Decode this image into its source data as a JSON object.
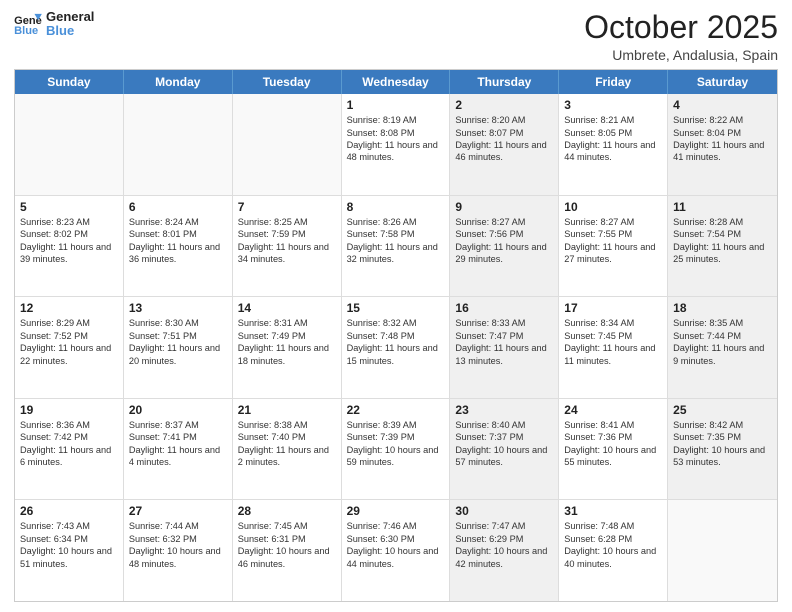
{
  "logo": {
    "general": "General",
    "blue": "Blue"
  },
  "header": {
    "title": "October 2025",
    "subtitle": "Umbrete, Andalusia, Spain"
  },
  "weekdays": [
    "Sunday",
    "Monday",
    "Tuesday",
    "Wednesday",
    "Thursday",
    "Friday",
    "Saturday"
  ],
  "weeks": [
    [
      {
        "day": "",
        "sunrise": "",
        "sunset": "",
        "daylight": "",
        "shaded": false,
        "empty": true
      },
      {
        "day": "",
        "sunrise": "",
        "sunset": "",
        "daylight": "",
        "shaded": false,
        "empty": true
      },
      {
        "day": "",
        "sunrise": "",
        "sunset": "",
        "daylight": "",
        "shaded": false,
        "empty": true
      },
      {
        "day": "1",
        "sunrise": "Sunrise: 8:19 AM",
        "sunset": "Sunset: 8:08 PM",
        "daylight": "Daylight: 11 hours and 48 minutes.",
        "shaded": false,
        "empty": false
      },
      {
        "day": "2",
        "sunrise": "Sunrise: 8:20 AM",
        "sunset": "Sunset: 8:07 PM",
        "daylight": "Daylight: 11 hours and 46 minutes.",
        "shaded": true,
        "empty": false
      },
      {
        "day": "3",
        "sunrise": "Sunrise: 8:21 AM",
        "sunset": "Sunset: 8:05 PM",
        "daylight": "Daylight: 11 hours and 44 minutes.",
        "shaded": false,
        "empty": false
      },
      {
        "day": "4",
        "sunrise": "Sunrise: 8:22 AM",
        "sunset": "Sunset: 8:04 PM",
        "daylight": "Daylight: 11 hours and 41 minutes.",
        "shaded": true,
        "empty": false
      }
    ],
    [
      {
        "day": "5",
        "sunrise": "Sunrise: 8:23 AM",
        "sunset": "Sunset: 8:02 PM",
        "daylight": "Daylight: 11 hours and 39 minutes.",
        "shaded": false,
        "empty": false
      },
      {
        "day": "6",
        "sunrise": "Sunrise: 8:24 AM",
        "sunset": "Sunset: 8:01 PM",
        "daylight": "Daylight: 11 hours and 36 minutes.",
        "shaded": false,
        "empty": false
      },
      {
        "day": "7",
        "sunrise": "Sunrise: 8:25 AM",
        "sunset": "Sunset: 7:59 PM",
        "daylight": "Daylight: 11 hours and 34 minutes.",
        "shaded": false,
        "empty": false
      },
      {
        "day": "8",
        "sunrise": "Sunrise: 8:26 AM",
        "sunset": "Sunset: 7:58 PM",
        "daylight": "Daylight: 11 hours and 32 minutes.",
        "shaded": false,
        "empty": false
      },
      {
        "day": "9",
        "sunrise": "Sunrise: 8:27 AM",
        "sunset": "Sunset: 7:56 PM",
        "daylight": "Daylight: 11 hours and 29 minutes.",
        "shaded": true,
        "empty": false
      },
      {
        "day": "10",
        "sunrise": "Sunrise: 8:27 AM",
        "sunset": "Sunset: 7:55 PM",
        "daylight": "Daylight: 11 hours and 27 minutes.",
        "shaded": false,
        "empty": false
      },
      {
        "day": "11",
        "sunrise": "Sunrise: 8:28 AM",
        "sunset": "Sunset: 7:54 PM",
        "daylight": "Daylight: 11 hours and 25 minutes.",
        "shaded": true,
        "empty": false
      }
    ],
    [
      {
        "day": "12",
        "sunrise": "Sunrise: 8:29 AM",
        "sunset": "Sunset: 7:52 PM",
        "daylight": "Daylight: 11 hours and 22 minutes.",
        "shaded": false,
        "empty": false
      },
      {
        "day": "13",
        "sunrise": "Sunrise: 8:30 AM",
        "sunset": "Sunset: 7:51 PM",
        "daylight": "Daylight: 11 hours and 20 minutes.",
        "shaded": false,
        "empty": false
      },
      {
        "day": "14",
        "sunrise": "Sunrise: 8:31 AM",
        "sunset": "Sunset: 7:49 PM",
        "daylight": "Daylight: 11 hours and 18 minutes.",
        "shaded": false,
        "empty": false
      },
      {
        "day": "15",
        "sunrise": "Sunrise: 8:32 AM",
        "sunset": "Sunset: 7:48 PM",
        "daylight": "Daylight: 11 hours and 15 minutes.",
        "shaded": false,
        "empty": false
      },
      {
        "day": "16",
        "sunrise": "Sunrise: 8:33 AM",
        "sunset": "Sunset: 7:47 PM",
        "daylight": "Daylight: 11 hours and 13 minutes.",
        "shaded": true,
        "empty": false
      },
      {
        "day": "17",
        "sunrise": "Sunrise: 8:34 AM",
        "sunset": "Sunset: 7:45 PM",
        "daylight": "Daylight: 11 hours and 11 minutes.",
        "shaded": false,
        "empty": false
      },
      {
        "day": "18",
        "sunrise": "Sunrise: 8:35 AM",
        "sunset": "Sunset: 7:44 PM",
        "daylight": "Daylight: 11 hours and 9 minutes.",
        "shaded": true,
        "empty": false
      }
    ],
    [
      {
        "day": "19",
        "sunrise": "Sunrise: 8:36 AM",
        "sunset": "Sunset: 7:42 PM",
        "daylight": "Daylight: 11 hours and 6 minutes.",
        "shaded": false,
        "empty": false
      },
      {
        "day": "20",
        "sunrise": "Sunrise: 8:37 AM",
        "sunset": "Sunset: 7:41 PM",
        "daylight": "Daylight: 11 hours and 4 minutes.",
        "shaded": false,
        "empty": false
      },
      {
        "day": "21",
        "sunrise": "Sunrise: 8:38 AM",
        "sunset": "Sunset: 7:40 PM",
        "daylight": "Daylight: 11 hours and 2 minutes.",
        "shaded": false,
        "empty": false
      },
      {
        "day": "22",
        "sunrise": "Sunrise: 8:39 AM",
        "sunset": "Sunset: 7:39 PM",
        "daylight": "Daylight: 10 hours and 59 minutes.",
        "shaded": false,
        "empty": false
      },
      {
        "day": "23",
        "sunrise": "Sunrise: 8:40 AM",
        "sunset": "Sunset: 7:37 PM",
        "daylight": "Daylight: 10 hours and 57 minutes.",
        "shaded": true,
        "empty": false
      },
      {
        "day": "24",
        "sunrise": "Sunrise: 8:41 AM",
        "sunset": "Sunset: 7:36 PM",
        "daylight": "Daylight: 10 hours and 55 minutes.",
        "shaded": false,
        "empty": false
      },
      {
        "day": "25",
        "sunrise": "Sunrise: 8:42 AM",
        "sunset": "Sunset: 7:35 PM",
        "daylight": "Daylight: 10 hours and 53 minutes.",
        "shaded": true,
        "empty": false
      }
    ],
    [
      {
        "day": "26",
        "sunrise": "Sunrise: 7:43 AM",
        "sunset": "Sunset: 6:34 PM",
        "daylight": "Daylight: 10 hours and 51 minutes.",
        "shaded": false,
        "empty": false
      },
      {
        "day": "27",
        "sunrise": "Sunrise: 7:44 AM",
        "sunset": "Sunset: 6:32 PM",
        "daylight": "Daylight: 10 hours and 48 minutes.",
        "shaded": false,
        "empty": false
      },
      {
        "day": "28",
        "sunrise": "Sunrise: 7:45 AM",
        "sunset": "Sunset: 6:31 PM",
        "daylight": "Daylight: 10 hours and 46 minutes.",
        "shaded": false,
        "empty": false
      },
      {
        "day": "29",
        "sunrise": "Sunrise: 7:46 AM",
        "sunset": "Sunset: 6:30 PM",
        "daylight": "Daylight: 10 hours and 44 minutes.",
        "shaded": false,
        "empty": false
      },
      {
        "day": "30",
        "sunrise": "Sunrise: 7:47 AM",
        "sunset": "Sunset: 6:29 PM",
        "daylight": "Daylight: 10 hours and 42 minutes.",
        "shaded": true,
        "empty": false
      },
      {
        "day": "31",
        "sunrise": "Sunrise: 7:48 AM",
        "sunset": "Sunset: 6:28 PM",
        "daylight": "Daylight: 10 hours and 40 minutes.",
        "shaded": false,
        "empty": false
      },
      {
        "day": "",
        "sunrise": "",
        "sunset": "",
        "daylight": "",
        "shaded": true,
        "empty": true
      }
    ]
  ]
}
